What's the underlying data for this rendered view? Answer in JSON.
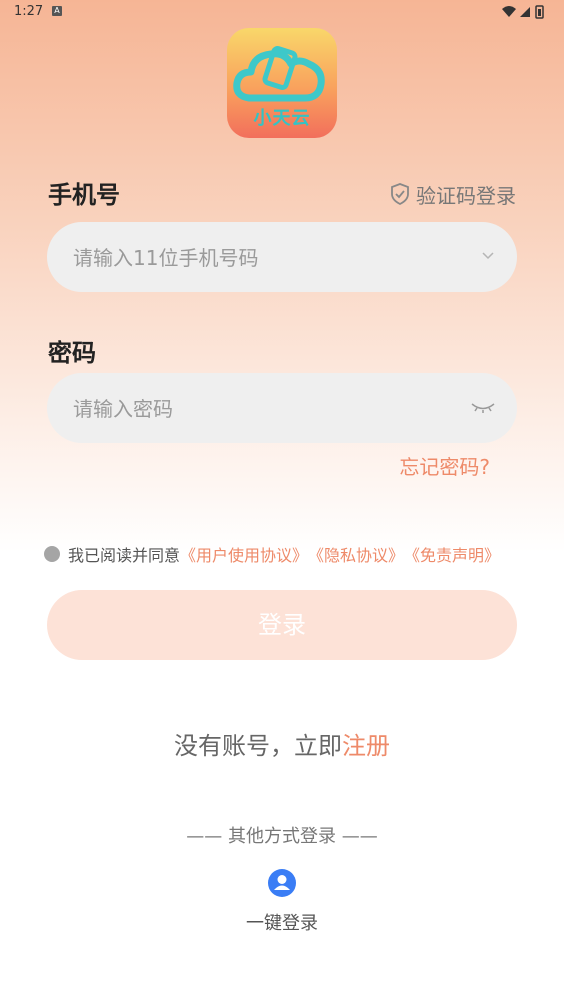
{
  "status_bar": {
    "time": "1:27",
    "notification": "A"
  },
  "app": {
    "logo_text": "小天云"
  },
  "phone": {
    "label": "手机号",
    "placeholder": "请输入11位手机号码"
  },
  "sms_login": {
    "label": "验证码登录"
  },
  "password": {
    "label": "密码",
    "placeholder": "请输入密码"
  },
  "forgot": {
    "label": "忘记密码?"
  },
  "agreement": {
    "prefix": "我已阅读并同意",
    "user_agreement": "《用户使用协议》",
    "privacy": "《隐私协议》",
    "disclaimer": "《免责声明》"
  },
  "login_button": {
    "label": "登录"
  },
  "register": {
    "prefix": "没有账号，立即",
    "link": "注册"
  },
  "other_login": {
    "divider": "—— 其他方式登录 ——"
  },
  "one_key_login": {
    "label": "一键登录"
  },
  "colors": {
    "accent": "#ee8a69",
    "button_bg": "#fde2d7",
    "input_bg": "#efefef",
    "one_key_icon": "#3a7df5"
  }
}
